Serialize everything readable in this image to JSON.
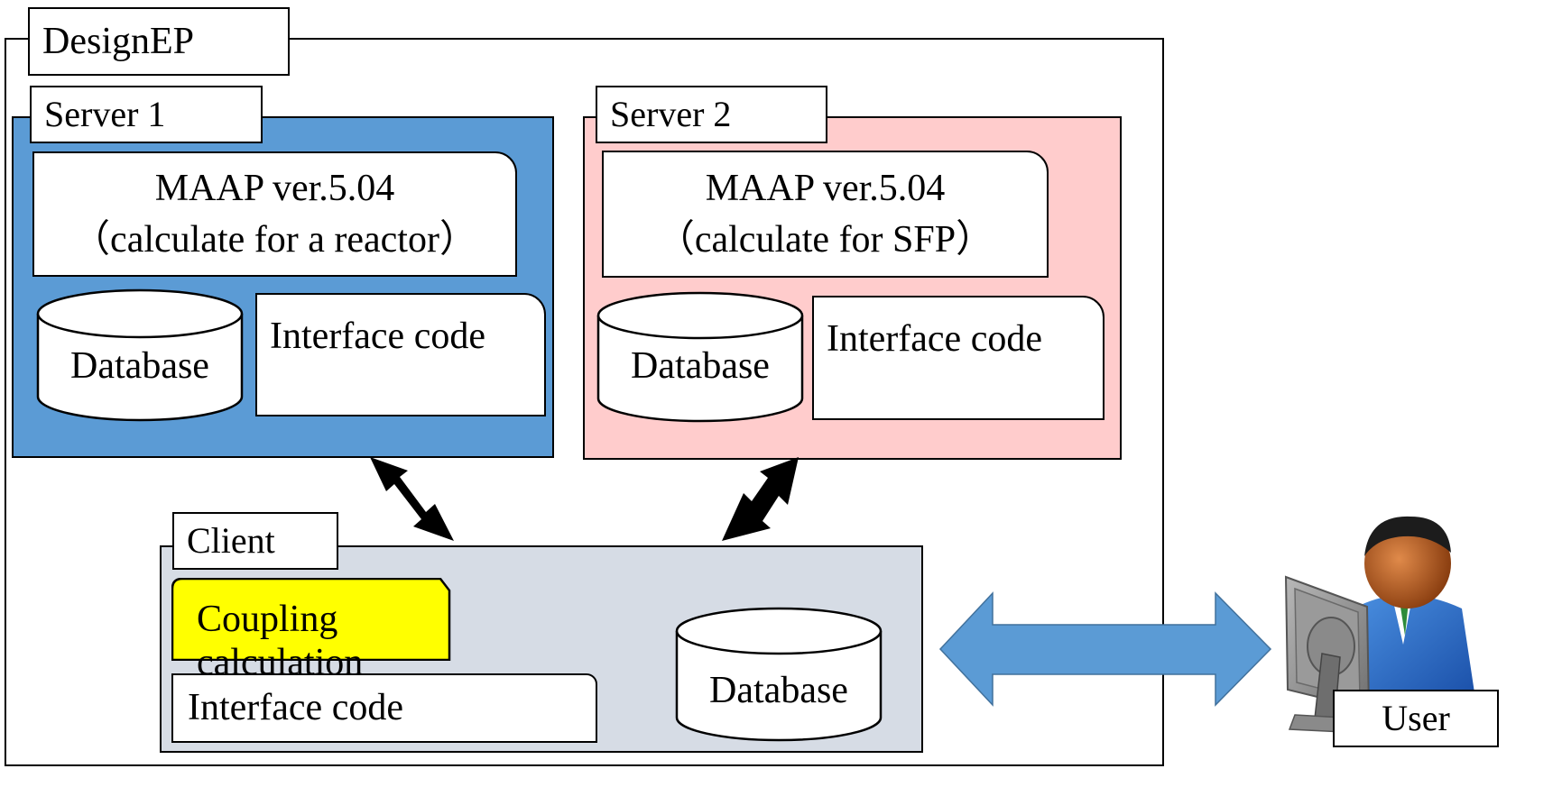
{
  "diagram": {
    "outer": {
      "label": "DesignEP"
    },
    "server1": {
      "label": "Server 1",
      "fill": "#5b9bd5",
      "maap_title": "MAAP ver.5.04",
      "maap_subtitle": "（calculate  for a reactor）",
      "database_label": "Database",
      "interface_label": "Interface code"
    },
    "server2": {
      "label": "Server 2",
      "fill": "#ffcccc",
      "maap_title": "MAAP ver.5.04",
      "maap_subtitle": "（calculate  for SFP）",
      "database_label": "Database",
      "interface_label": "Interface code"
    },
    "client": {
      "label": "Client",
      "fill": "#d6dce5",
      "coupling_label": "Coupling calculation",
      "coupling_fill": "#ffff00",
      "interface_label": "Interface code",
      "database_label": "Database"
    },
    "user": {
      "label": "User",
      "icon": "user-at-computer-icon"
    },
    "connectors": {
      "server1_client": "double-headed-arrow",
      "server2_client": "double-headed-arrow",
      "client_user": "double-headed-block-arrow",
      "client_user_color": "#5b9bd5"
    }
  }
}
